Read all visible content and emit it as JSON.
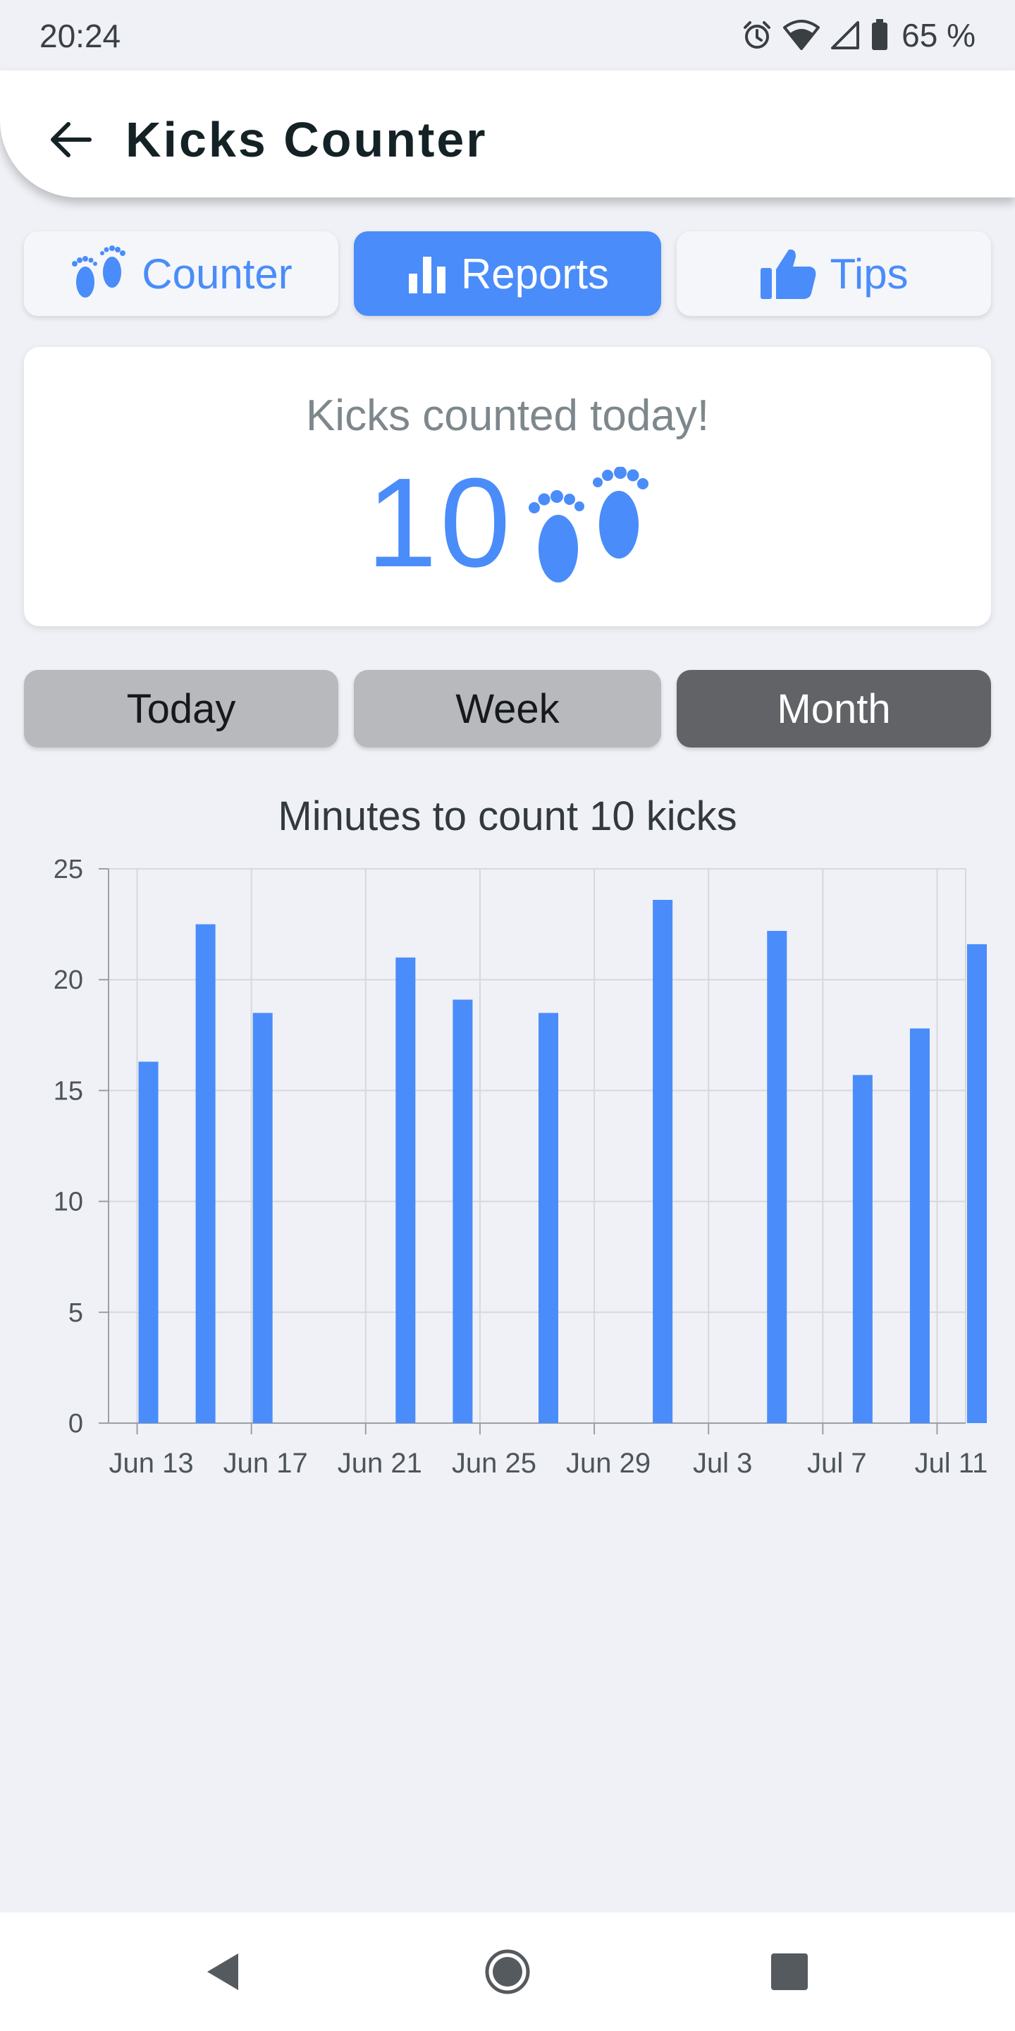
{
  "status_bar": {
    "time": "20:24",
    "battery": "65 %",
    "icons": [
      "alarm-icon",
      "wifi-icon",
      "signal-icon",
      "battery-icon"
    ]
  },
  "header": {
    "title": "Kicks Counter",
    "back_icon": "arrow-left-icon"
  },
  "tabs": [
    {
      "label": "Counter",
      "icon": "baby-feet-icon",
      "active": false
    },
    {
      "label": "Reports",
      "icon": "bar-chart-icon",
      "active": true
    },
    {
      "label": "Tips",
      "icon": "thumbs-up-icon",
      "active": false
    }
  ],
  "summary": {
    "title": "Kicks counted today!",
    "count": "10",
    "icon": "baby-feet-icon"
  },
  "periods": [
    {
      "label": "Today",
      "active": false
    },
    {
      "label": "Week",
      "active": false
    },
    {
      "label": "Month",
      "active": true
    }
  ],
  "colors": {
    "accent": "#4a8cf9",
    "background": "#eff1f6",
    "segment_active": "#616366",
    "segment_inactive": "#b7b9bd"
  },
  "chart_data": {
    "type": "bar",
    "title": "Minutes to count 10 kicks",
    "xlabel": "",
    "ylabel": "",
    "ylim": [
      0,
      25
    ],
    "yticks": [
      0,
      5,
      10,
      15,
      20,
      25
    ],
    "x_axis_type": "date",
    "xlim": [
      "2025-06-12",
      "2025-07-12"
    ],
    "xticks": [
      {
        "date": "2025-06-13",
        "label": "Jun 13"
      },
      {
        "date": "2025-06-17",
        "label": "Jun 17"
      },
      {
        "date": "2025-06-21",
        "label": "Jun 21"
      },
      {
        "date": "2025-06-25",
        "label": "Jun 25"
      },
      {
        "date": "2025-06-29",
        "label": "Jun 29"
      },
      {
        "date": "2025-07-03",
        "label": "Jul 3"
      },
      {
        "date": "2025-07-07",
        "label": "Jul 7"
      },
      {
        "date": "2025-07-11",
        "label": "Jul 11"
      }
    ],
    "grid": true,
    "points": [
      {
        "date": "2025-06-13",
        "value": 16.3
      },
      {
        "date": "2025-06-15",
        "value": 22.5
      },
      {
        "date": "2025-06-17",
        "value": 18.5
      },
      {
        "date": "2025-06-22",
        "value": 21.0
      },
      {
        "date": "2025-06-24",
        "value": 19.1
      },
      {
        "date": "2025-06-27",
        "value": 18.5
      },
      {
        "date": "2025-07-01",
        "value": 23.6
      },
      {
        "date": "2025-07-05",
        "value": 22.2
      },
      {
        "date": "2025-07-08",
        "value": 15.7
      },
      {
        "date": "2025-07-10",
        "value": 17.8
      },
      {
        "date": "2025-07-12",
        "value": 21.6
      }
    ]
  },
  "nav_bar": {
    "icons": [
      "nav-back-icon",
      "nav-home-icon",
      "nav-recents-icon"
    ]
  }
}
